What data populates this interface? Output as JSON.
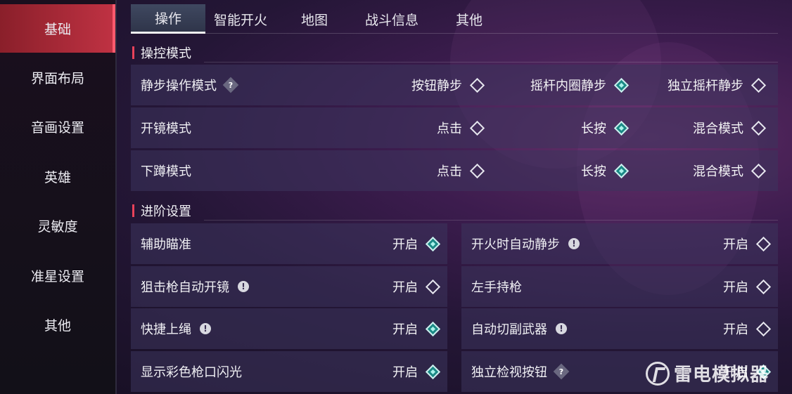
{
  "sidebar": {
    "items": [
      {
        "label": "基础",
        "active": true
      },
      {
        "label": "界面布局",
        "active": false
      },
      {
        "label": "音画设置",
        "active": false
      },
      {
        "label": "英雄",
        "active": false
      },
      {
        "label": "灵敏度",
        "active": false
      },
      {
        "label": "准星设置",
        "active": false
      },
      {
        "label": "其他",
        "active": false
      }
    ]
  },
  "tabs": [
    {
      "label": "操作",
      "active": true
    },
    {
      "label": "智能开火",
      "active": false
    },
    {
      "label": "地图",
      "active": false
    },
    {
      "label": "战斗信息",
      "active": false
    },
    {
      "label": "其他",
      "active": false
    }
  ],
  "sections": {
    "control_mode": {
      "title": "操控模式"
    },
    "advanced": {
      "title": "进阶设置"
    }
  },
  "control_rows": [
    {
      "label": "静步操作模式",
      "icon": "question-icon",
      "options": [
        {
          "label": "按钮静步",
          "selected": false
        },
        {
          "label": "摇杆内圈静步",
          "selected": true
        },
        {
          "label": "独立摇杆静步",
          "selected": false
        }
      ]
    },
    {
      "label": "开镜模式",
      "icon": "",
      "options": [
        {
          "label": "点击",
          "selected": false
        },
        {
          "label": "长按",
          "selected": true
        },
        {
          "label": "混合模式",
          "selected": false
        }
      ]
    },
    {
      "label": "下蹲模式",
      "icon": "",
      "options": [
        {
          "label": "点击",
          "selected": false
        },
        {
          "label": "长按",
          "selected": true
        },
        {
          "label": "混合模式",
          "selected": false
        }
      ]
    }
  ],
  "advanced_rows": [
    {
      "label": "辅助瞄准",
      "icon": "",
      "value": "开启",
      "checked": true
    },
    {
      "label": "开火时自动静步",
      "icon": "info-icon",
      "value": "开启",
      "checked": false
    },
    {
      "label": "狙击枪自动开镜",
      "icon": "info-icon",
      "value": "开启",
      "checked": false
    },
    {
      "label": "左手持枪",
      "icon": "",
      "value": "开启",
      "checked": false
    },
    {
      "label": "快捷上绳",
      "icon": "info-icon",
      "value": "开启",
      "checked": true
    },
    {
      "label": "自动切副武器",
      "icon": "info-icon",
      "value": "开启",
      "checked": false
    },
    {
      "label": "显示彩色枪口闪光",
      "icon": "",
      "value": "开启",
      "checked": true
    },
    {
      "label": "独立检视按钮",
      "icon": "question-icon",
      "value": "开启",
      "checked": true
    }
  ],
  "icons": {
    "question": "?",
    "info": "!"
  },
  "watermark": {
    "text": "雷电模拟器"
  },
  "colors": {
    "accent": "#c03243",
    "selected_diamond": "#1b8a86"
  }
}
